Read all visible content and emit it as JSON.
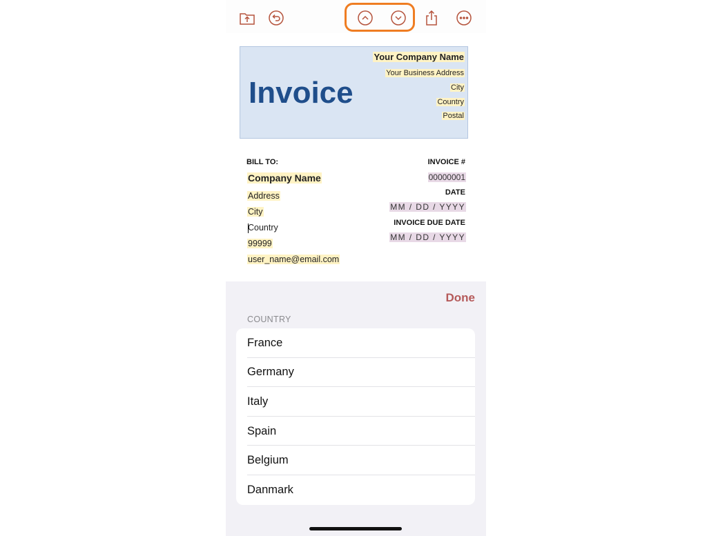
{
  "toolbar": {
    "icons": [
      "folder-upload-icon",
      "undo-icon",
      "chevron-up-circle-icon",
      "chevron-down-circle-icon",
      "share-icon",
      "more-icon"
    ],
    "accent_color": "#b5533c",
    "highlight_color": "#ef7d22"
  },
  "document": {
    "title": "Invoice",
    "company": {
      "name": "Your Company Name",
      "address": "Your Business Address",
      "city": "City",
      "country": "Country",
      "postal": "Postal"
    },
    "bill_to": {
      "label": "BILL TO:",
      "company_name": "Company Name",
      "address": "Address",
      "city": "City",
      "country": "Country",
      "zip": "99999",
      "email": "user_name@email.com"
    },
    "invoice_number_label": "INVOICE #",
    "invoice_number": "00000001",
    "date_label": "DATE",
    "date_value": "MM / DD / YYYY",
    "due_date_label": "INVOICE DUE DATE",
    "due_date_value": "MM / DD / YYYY"
  },
  "picker": {
    "done_label": "Done",
    "section_header": "COUNTRY",
    "options": [
      "France",
      "Germany",
      "Italy",
      "Spain",
      "Belgium",
      "Danmark"
    ]
  }
}
